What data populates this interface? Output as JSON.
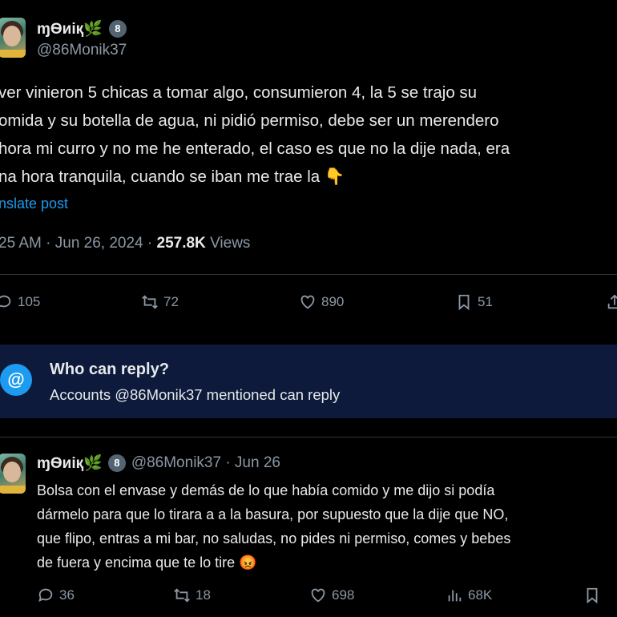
{
  "post": {
    "display_name": "ɱѲиiқ🌿",
    "badge": "8",
    "handle": "@86Monik37",
    "text_lines": [
      "ver vinieron 5 chicas a tomar algo, consumieron 4, la 5 se trajo su",
      "omida y su botella de agua, ni pidió permiso, debe ser un merendero",
      "hora mi curro y no me he enterado, el caso es que no la dije nada, era",
      "na hora tranquila, cuando se iban me trae la 👇"
    ],
    "translate_link": "nslate post",
    "time": "25 AM · Jun 26, 2024 · ",
    "views_count": "257.8K",
    "views_label": " Views",
    "stats": {
      "replies": "105",
      "reposts": "72",
      "likes": "890",
      "bookmarks": "51"
    }
  },
  "reply_restriction": {
    "icon": "@",
    "title": "Who can reply?",
    "subtitle": "Accounts @86Monik37 mentioned can reply"
  },
  "reply": {
    "display_name": "ɱѲиiқ🌿",
    "badge": "8",
    "handle_date": "@86Monik37 · Jun 26",
    "text_lines": [
      "Bolsa con el envase y demás de lo que había comido y me dijo si podía",
      "dármelo para que lo tirara a a la basura, por supuesto que la dije que NO,",
      "que flipo, entras a mi bar, no saludas, no pides ni permiso, comes y bebes",
      "de fuera y encima que te lo tire 😡"
    ],
    "stats": {
      "replies": "36",
      "reposts": "18",
      "likes": "698",
      "views": "68K"
    }
  },
  "colors": {
    "accent": "#1d9bf0",
    "banner": "#0d1a3b",
    "muted": "#8b98a5"
  }
}
